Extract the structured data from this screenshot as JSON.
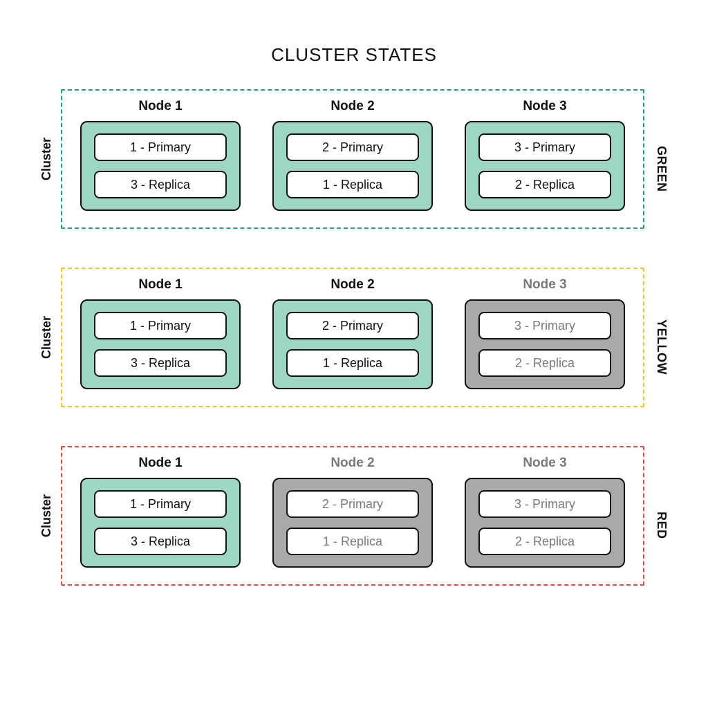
{
  "title": "CLUSTER STATES",
  "leftLabel": "Cluster",
  "states": [
    {
      "label": "GREEN",
      "class": "cluster-green",
      "nodes": [
        {
          "title": "Node 1",
          "active": true,
          "shards": [
            "1 - Primary",
            "3 - Replica"
          ]
        },
        {
          "title": "Node 2",
          "active": true,
          "shards": [
            "2 - Primary",
            "1 - Replica"
          ]
        },
        {
          "title": "Node 3",
          "active": true,
          "shards": [
            "3 - Primary",
            "2 - Replica"
          ]
        }
      ]
    },
    {
      "label": "YELLOW",
      "class": "cluster-yellow",
      "nodes": [
        {
          "title": "Node 1",
          "active": true,
          "shards": [
            "1 - Primary",
            "3 - Replica"
          ]
        },
        {
          "title": "Node 2",
          "active": true,
          "shards": [
            "2 - Primary",
            "1 - Replica"
          ]
        },
        {
          "title": "Node 3",
          "active": false,
          "shards": [
            "3 - Primary",
            "2 - Replica"
          ]
        }
      ]
    },
    {
      "label": "RED",
      "class": "cluster-red",
      "nodes": [
        {
          "title": "Node 1",
          "active": true,
          "shards": [
            "1 - Primary",
            "3 - Replica"
          ]
        },
        {
          "title": "Node 2",
          "active": false,
          "shards": [
            "2 - Primary",
            "1 - Replica"
          ]
        },
        {
          "title": "Node 3",
          "active": false,
          "shards": [
            "3 - Primary",
            "2 - Replica"
          ]
        }
      ]
    }
  ]
}
